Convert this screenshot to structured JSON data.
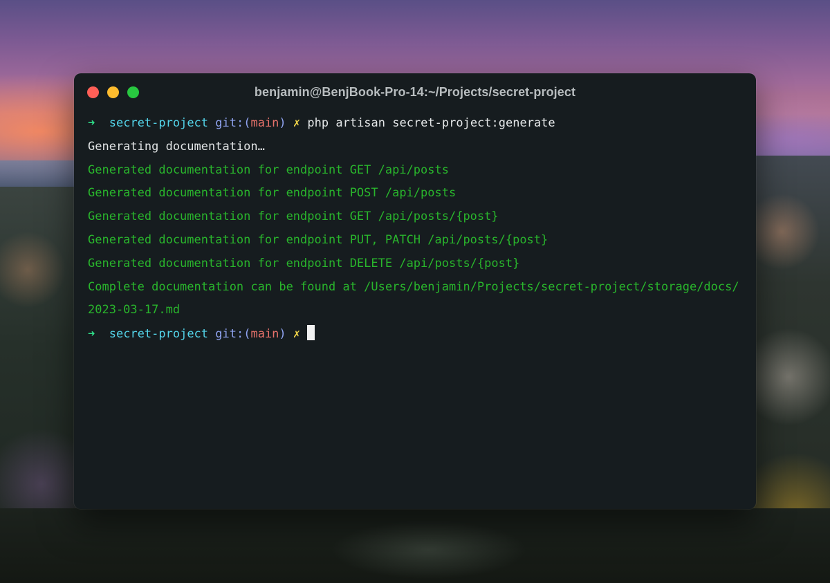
{
  "window": {
    "title": "benjamin@BenjBook-Pro-14:~/Projects/secret-project"
  },
  "prompt": {
    "arrow": "➜",
    "directory": "secret-project",
    "git_label": "git:(",
    "branch": "main",
    "git_close": ")",
    "dirty_marker": "✗"
  },
  "command": "php artisan secret-project:generate",
  "output": [
    "Generating documentation…",
    "Generated documentation for endpoint GET /api/posts",
    "Generated documentation for endpoint POST /api/posts",
    "Generated documentation for endpoint GET /api/posts/{post}",
    "Generated documentation for endpoint PUT, PATCH /api/posts/{post}",
    "Generated documentation for endpoint DELETE /api/posts/{post}",
    "Complete documentation can be found at /Users/benjamin/Projects/secret-project/storage/docs/",
    "2023-03-17.md"
  ],
  "colors": {
    "terminal_background": "#161c1f",
    "success_text": "#29b52c",
    "prompt_arrow": "#2fe08a",
    "directory": "#53d3e8",
    "git_label": "#8fa3f0",
    "branch": "#e8726b",
    "dirty_marker": "#f1d54a",
    "close_button": "#ff5f57",
    "minimize_button": "#febc2e",
    "zoom_button": "#28c840"
  }
}
